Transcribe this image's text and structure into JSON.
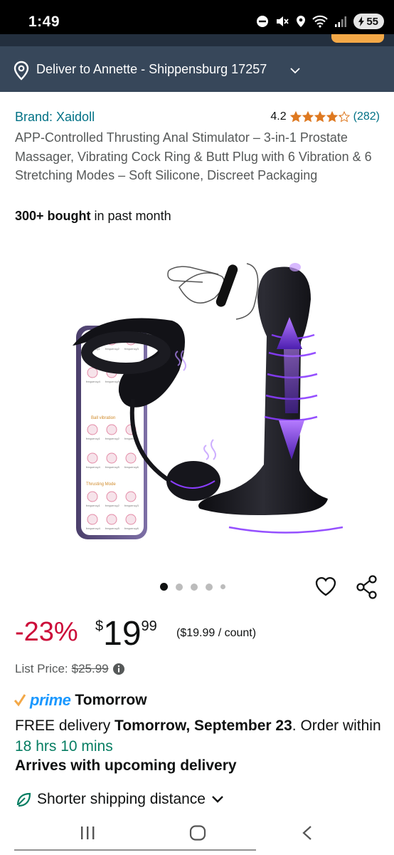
{
  "status_bar": {
    "time": "1:49",
    "battery": "55"
  },
  "delivery_location": {
    "text": "Deliver to Annette - Shippensburg 17257"
  },
  "product": {
    "brand": "Brand: Xaidoll",
    "rating": "4.2",
    "stars": 4.2,
    "rating_count": "(282)",
    "title": "APP-Controlled Thrusting Anal Stimulator – 3-in-1 Prostate Massager, Vibrating Cock Ring & Butt Plug with 6 Vibration & 6 Stretching Modes – Soft Silicone, Discreet Packaging",
    "bought_count": "300+ bought",
    "bought_suffix": " in past month",
    "image": {
      "phone_app_labels": [
        "frequency1",
        "frequency2",
        "frequency3",
        "frequency4",
        "frequency5",
        "frequency6"
      ],
      "phone_section_ball": "Ball vibration",
      "phone_section_thrust": "Thrusting Mode"
    },
    "image_carousel": {
      "total": 5,
      "active_index": 0
    }
  },
  "pricing": {
    "discount": "-23%",
    "currency": "$",
    "price_whole": "19",
    "price_fraction": "99",
    "unit_price": "($19.99 / count)",
    "list_price_label": "List Price: ",
    "list_price": "$25.99"
  },
  "delivery": {
    "prime_label": "prime",
    "prime_when": "Tomorrow",
    "line_prefix": "FREE delivery ",
    "line_date": "Tomorrow, September 23",
    "line_mid": ". Order within ",
    "timer": "18 hrs 10 mins",
    "arrives": "Arrives with upcoming delivery",
    "shipping_note": "Shorter shipping distance"
  },
  "colors": {
    "status_bar": "#000000",
    "header_dark": "#232f3e",
    "deliver_bar": "#37475a",
    "link": "#007185",
    "discount_red": "#cc0c39",
    "timer_green": "#067d62",
    "prime_blue": "#1a98ff",
    "star_orange": "#de7921",
    "accent_purple": "#8a3dff"
  },
  "icons": [
    "location-pin-icon",
    "chevron-down-icon",
    "star-icon",
    "heart-icon",
    "share-icon",
    "info-icon",
    "leaf-icon",
    "recent-apps-icon",
    "home-icon",
    "back-icon"
  ]
}
